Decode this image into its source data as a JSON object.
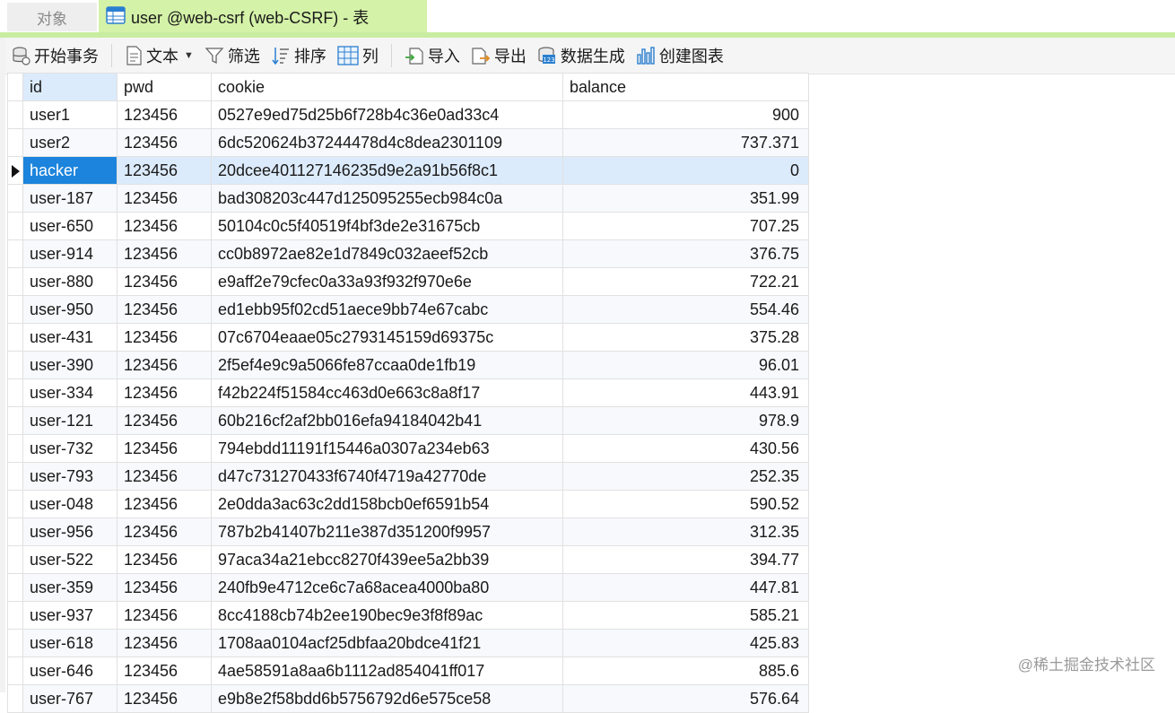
{
  "tabs": {
    "objects": "对象",
    "active": "user @web-csrf (web-CSRF) - 表"
  },
  "toolbar": {
    "begin_transaction": "开始事务",
    "text": "文本",
    "filter": "筛选",
    "sort": "排序",
    "columns": "列",
    "import": "导入",
    "export": "导出",
    "data_generation": "数据生成",
    "create_chart": "创建图表"
  },
  "table": {
    "headers": [
      "id",
      "pwd",
      "cookie",
      "balance"
    ],
    "selected_row": 2,
    "rows": [
      {
        "id": "user1",
        "pwd": "123456",
        "cookie": "0527e9ed75d25b6f728b4c36e0ad33c4",
        "balance": "900"
      },
      {
        "id": "user2",
        "pwd": "123456",
        "cookie": "6dc520624b37244478d4c8dea2301109",
        "balance": "737.371"
      },
      {
        "id": "hacker",
        "pwd": "123456",
        "cookie": "20dcee401127146235d9e2a91b56f8c1",
        "balance": "0"
      },
      {
        "id": "user-187",
        "pwd": "123456",
        "cookie": "bad308203c447d125095255ecb984c0a",
        "balance": "351.99"
      },
      {
        "id": "user-650",
        "pwd": "123456",
        "cookie": "50104c0c5f40519f4bf3de2e31675cb",
        "balance": "707.25"
      },
      {
        "id": "user-914",
        "pwd": "123456",
        "cookie": "cc0b8972ae82e1d7849c032aeef52cb",
        "balance": "376.75"
      },
      {
        "id": "user-880",
        "pwd": "123456",
        "cookie": "e9aff2e79cfec0a33a93f932f970e6e",
        "balance": "722.21"
      },
      {
        "id": "user-950",
        "pwd": "123456",
        "cookie": "ed1ebb95f02cd51aece9bb74e67cabc",
        "balance": "554.46"
      },
      {
        "id": "user-431",
        "pwd": "123456",
        "cookie": "07c6704eaae05c2793145159d69375c",
        "balance": "375.28"
      },
      {
        "id": "user-390",
        "pwd": "123456",
        "cookie": "2f5ef4e9c9a5066fe87ccaa0de1fb19",
        "balance": "96.01"
      },
      {
        "id": "user-334",
        "pwd": "123456",
        "cookie": "f42b224f51584cc463d0e663c8a8f17",
        "balance": "443.91"
      },
      {
        "id": "user-121",
        "pwd": "123456",
        "cookie": "60b216cf2af2bb016efa94184042b41",
        "balance": "978.9"
      },
      {
        "id": "user-732",
        "pwd": "123456",
        "cookie": "794ebdd11191f15446a0307a234eb63",
        "balance": "430.56"
      },
      {
        "id": "user-793",
        "pwd": "123456",
        "cookie": "d47c731270433f6740f4719a42770de",
        "balance": "252.35"
      },
      {
        "id": "user-048",
        "pwd": "123456",
        "cookie": "2e0dda3ac63c2dd158bcb0ef6591b54",
        "balance": "590.52"
      },
      {
        "id": "user-956",
        "pwd": "123456",
        "cookie": "787b2b41407b211e387d351200f9957",
        "balance": "312.35"
      },
      {
        "id": "user-522",
        "pwd": "123456",
        "cookie": "97aca34a21ebcc8270f439ee5a2bb39",
        "balance": "394.77"
      },
      {
        "id": "user-359",
        "pwd": "123456",
        "cookie": "240fb9e4712ce6c7a68acea4000ba80",
        "balance": "447.81"
      },
      {
        "id": "user-937",
        "pwd": "123456",
        "cookie": "8cc4188cb74b2ee190bec9e3f8f89ac",
        "balance": "585.21"
      },
      {
        "id": "user-618",
        "pwd": "123456",
        "cookie": "1708aa0104acf25dbfaa20bdce41f21",
        "balance": "425.83"
      },
      {
        "id": "user-646",
        "pwd": "123456",
        "cookie": "4ae58591a8aa6b1112ad854041ff017",
        "balance": "885.6"
      },
      {
        "id": "user-767",
        "pwd": "123456",
        "cookie": "e9b8e2f58bdd6b5756792d6e575ce58",
        "balance": "576.64"
      }
    ]
  },
  "watermark": "@稀土掘金技术社区",
  "colors": {
    "tab_active_bg": "#d4f2a8",
    "selection": "#1c84dc",
    "selected_row_bg": "#dcebfb"
  },
  "icons": {
    "table": "table-icon",
    "begin_transaction": "database-icon",
    "text": "document-icon",
    "filter": "funnel-icon",
    "sort": "sort-icon",
    "columns": "grid-icon",
    "import": "import-icon",
    "export": "export-icon",
    "data_generation": "data-gen-icon",
    "create_chart": "chart-icon"
  }
}
